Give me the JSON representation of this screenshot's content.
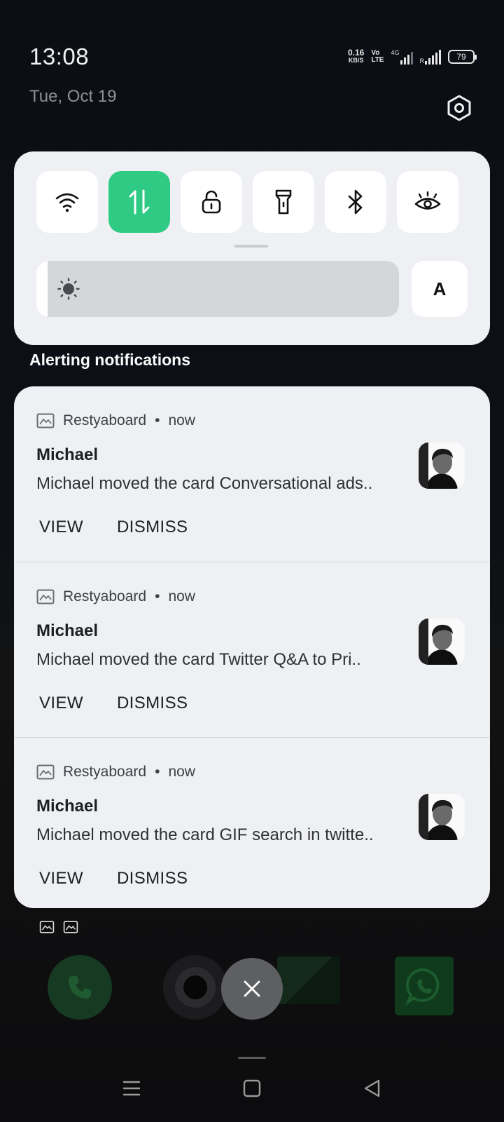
{
  "status": {
    "time": "13:08",
    "date": "Tue, Oct 19",
    "net_speed_value": "0.16",
    "net_speed_unit": "KB/S",
    "volte_top": "Vo",
    "volte_bottom": "LTE",
    "network_type": "4G",
    "roaming": "R",
    "battery": "79"
  },
  "quick_settings": {
    "tiles": [
      {
        "name": "wifi-icon",
        "active": false
      },
      {
        "name": "mobile-data-icon",
        "active": true
      },
      {
        "name": "rotation-lock-icon",
        "active": false
      },
      {
        "name": "flashlight-icon",
        "active": false
      },
      {
        "name": "bluetooth-icon",
        "active": false
      },
      {
        "name": "eye-comfort-icon",
        "active": false
      }
    ],
    "brightness_level": 0.03,
    "auto_brightness_label": "A"
  },
  "section_title": "Alerting notifications",
  "notifications": [
    {
      "app": "Restyaboard",
      "separator": "•",
      "time": "now",
      "title": "Michael",
      "text": "Michael moved the card Conversational ads..",
      "actions": [
        "VIEW",
        "DISMISS"
      ]
    },
    {
      "app": "Restyaboard",
      "separator": "•",
      "time": "now",
      "title": "Michael",
      "text": "Michael moved the card Twitter Q&A to  Pri..",
      "actions": [
        "VIEW",
        "DISMISS"
      ]
    },
    {
      "app": "Restyaboard",
      "separator": "•",
      "time": "now",
      "title": "Michael",
      "text": "Michael moved the card GIF search in twitte..",
      "actions": [
        "VIEW",
        "DISMISS"
      ]
    }
  ],
  "colors": {
    "accent_green": "#2fcb84",
    "panel_bg": "#eff0f4"
  }
}
